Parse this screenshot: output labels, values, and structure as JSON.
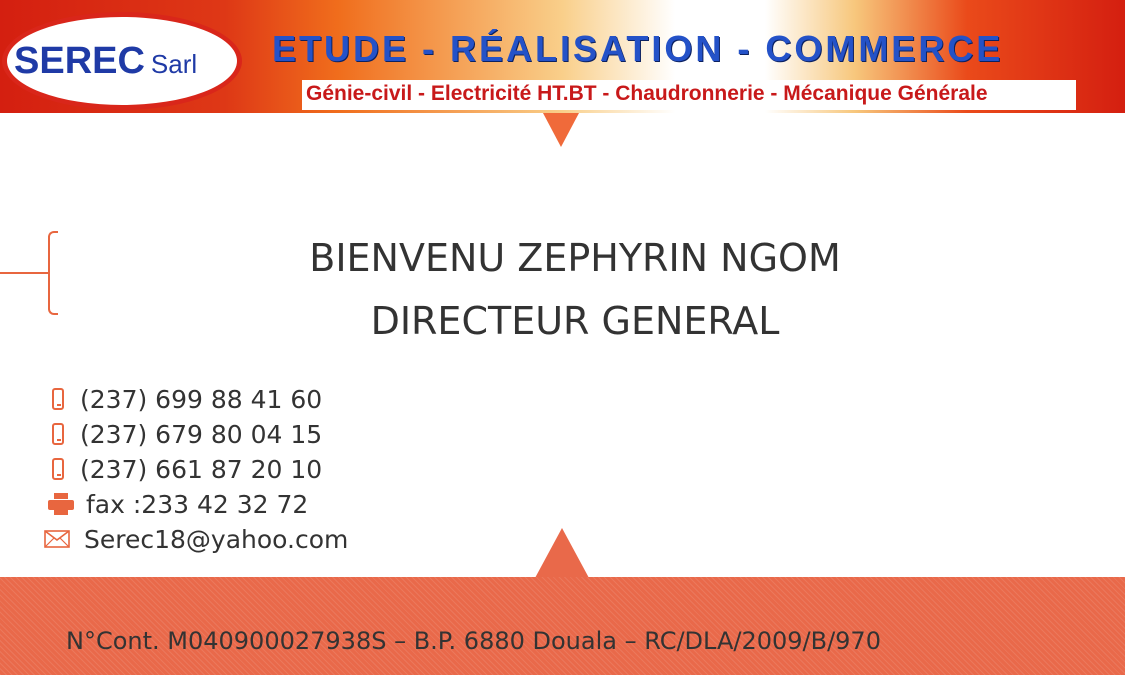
{
  "header": {
    "logo_main": "SEREC",
    "logo_suffix": "Sarl",
    "tagline": "ETUDE - RÉALISATION - COMMERCE",
    "services": "Génie-civil - Electricité HT.BT - Chaudronnerie - Mécanique Générale"
  },
  "person": {
    "name": "BIENVENU ZEPHYRIN NGOM",
    "title": "DIRECTEUR GENERAL"
  },
  "contacts": [
    {
      "icon": "mobile-phone-icon",
      "text": "(237) 699 88 41 60"
    },
    {
      "icon": "mobile-phone-icon",
      "text": "(237) 679 80 04 15"
    },
    {
      "icon": "mobile-phone-icon",
      "text": "(237) 661 87 20 10"
    },
    {
      "icon": "printer-icon",
      "text": "fax :233 42 32 72"
    },
    {
      "icon": "envelope-icon",
      "text": "Serec18@yahoo.com"
    }
  ],
  "footer": {
    "registration": "N°Cont. M040900027938S – B.P. 6880  Douala – RC/DLA/2009/B/970"
  },
  "colors": {
    "accent": "#e8663f",
    "banner_red": "#d41f10",
    "logo_blue": "#1f3aa6",
    "text": "#333333"
  }
}
